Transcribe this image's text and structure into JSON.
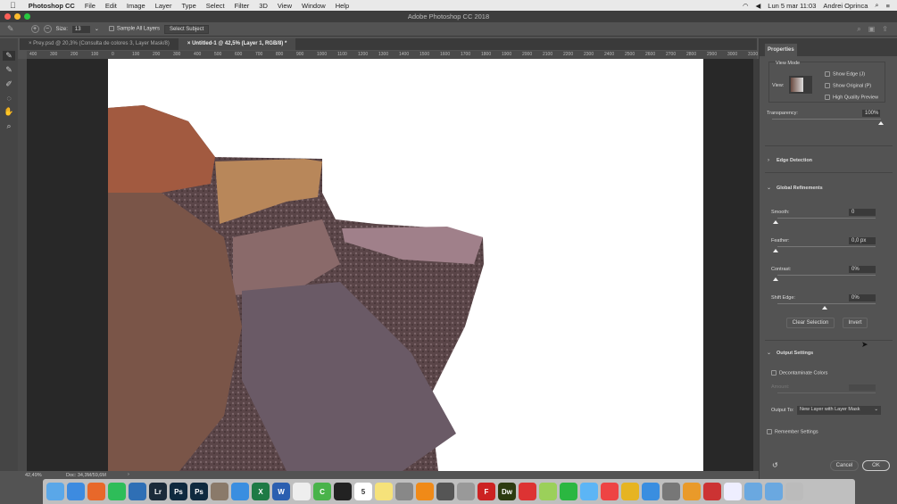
{
  "menubar": {
    "app": "Photoshop CC",
    "items": [
      "File",
      "Edit",
      "Image",
      "Layer",
      "Type",
      "Select",
      "Filter",
      "3D",
      "View",
      "Window",
      "Help"
    ],
    "datetime": "Lun 5 mar  11:03",
    "user": "Andrei Oprinca"
  },
  "window": {
    "title": "Adobe Photoshop CC 2018"
  },
  "options": {
    "size_label": "Size:",
    "size_value": "13",
    "sample_all_layers": "Sample All Layers",
    "select_subject": "Select Subject"
  },
  "tabs": [
    {
      "label": "Prey.psd @ 20,3% (Consulta de colores 3, Layer Mask/8)"
    },
    {
      "label": "Untitled-1 @ 42,5% (Layer 1, RGB/8) *"
    }
  ],
  "ruler": [
    "400",
    "300",
    "200",
    "100",
    "0",
    "100",
    "200",
    "300",
    "400",
    "500",
    "600",
    "700",
    "800",
    "900",
    "1000",
    "1100",
    "1200",
    "1300",
    "1400",
    "1500",
    "1600",
    "1700",
    "1800",
    "1900",
    "2000",
    "2100",
    "2200",
    "2300",
    "2400",
    "2500",
    "2600",
    "2700",
    "2800",
    "2900",
    "3000",
    "3100",
    "3200"
  ],
  "statusbar": {
    "zoom": "42,49%",
    "doc": "Doc: 34,3M/59,6M"
  },
  "panel": {
    "tab": "Properties",
    "view_mode": "View Mode",
    "view_label": "View:",
    "show_edge": "Show Edge (J)",
    "show_original": "Show Original (P)",
    "hq_preview": "High Quality Preview",
    "transparency_label": "Transparency:",
    "transparency_value": "100%",
    "transparency": 100,
    "edge_detection": "Edge Detection",
    "global_refinements": "Global Refinements",
    "smooth_label": "Smooth:",
    "smooth_value": "0",
    "feather_label": "Feather:",
    "feather_value": "0,0 px",
    "contrast_label": "Contrast:",
    "contrast_value": "0%",
    "shift_edge_label": "Shift Edge:",
    "shift_edge_value": "0%",
    "clear_selection": "Clear Selection",
    "invert": "Invert",
    "output_settings": "Output Settings",
    "decontaminate": "Decontaminate Colors",
    "amount_label": "Amount:",
    "output_to_label": "Output To:",
    "output_to_value": "New Layer with Layer Mask",
    "remember": "Remember Settings",
    "cancel": "Cancel",
    "ok": "OK"
  },
  "dock": [
    {
      "name": "Finder",
      "c": "#5aa7e8",
      "t": ""
    },
    {
      "name": "Chrome",
      "c": "#3d8be0",
      "t": ""
    },
    {
      "name": "Firefox",
      "c": "#e8682a",
      "t": ""
    },
    {
      "name": "Spotify",
      "c": "#2ebd59",
      "t": ""
    },
    {
      "name": "Thunderbird",
      "c": "#2f6fb5",
      "t": ""
    },
    {
      "name": "Lightroom",
      "c": "#1b2b3a",
      "t": "Lr"
    },
    {
      "name": "Photoshop",
      "c": "#0f2a3f",
      "t": "Ps"
    },
    {
      "name": "Photoshop 2",
      "c": "#0f2a3f",
      "t": "Ps"
    },
    {
      "name": "Preview",
      "c": "#8a7a6a",
      "t": ""
    },
    {
      "name": "Safari",
      "c": "#3a8ee0",
      "t": ""
    },
    {
      "name": "Excel",
      "c": "#1e7a45",
      "t": "X"
    },
    {
      "name": "Word",
      "c": "#2b5fb0",
      "t": "W"
    },
    {
      "name": "Pages",
      "c": "#eee",
      "t": ""
    },
    {
      "name": "Camtasia",
      "c": "#49b34a",
      "t": "C"
    },
    {
      "name": "Activity",
      "c": "#222",
      "t": ""
    },
    {
      "name": "Calendar",
      "c": "#fff",
      "t": "5"
    },
    {
      "name": "Notes",
      "c": "#f6e27a",
      "t": ""
    },
    {
      "name": "Preferences",
      "c": "#888",
      "t": ""
    },
    {
      "name": "VLC",
      "c": "#f08a18",
      "t": ""
    },
    {
      "name": "Clapper",
      "c": "#555",
      "t": ""
    },
    {
      "name": "Books",
      "c": "#999",
      "t": ""
    },
    {
      "name": "FileZilla",
      "c": "#c22",
      "t": "F"
    },
    {
      "name": "Dreamweaver",
      "c": "#2d3b10",
      "t": "Dw"
    },
    {
      "name": "Mail",
      "c": "#d33",
      "t": ""
    },
    {
      "name": "Maps",
      "c": "#9bd05a",
      "t": ""
    },
    {
      "name": "WhatsApp",
      "c": "#2bb741",
      "t": ""
    },
    {
      "name": "Messages",
      "c": "#5cb5f5",
      "t": ""
    },
    {
      "name": "Recorder",
      "c": "#e44",
      "t": ""
    },
    {
      "name": "Sound",
      "c": "#e6b422",
      "t": ""
    },
    {
      "name": "App Store",
      "c": "#3a8ee0",
      "t": ""
    },
    {
      "name": "Tools",
      "c": "#777",
      "t": ""
    },
    {
      "name": "Cog",
      "c": "#e99a2a",
      "t": ""
    },
    {
      "name": "Photo",
      "c": "#c33",
      "t": ""
    },
    {
      "name": "Doc",
      "c": "#eef",
      "t": ""
    },
    {
      "name": "Folder1",
      "c": "#6aa8e0",
      "t": ""
    },
    {
      "name": "Folder2",
      "c": "#6aa8e0",
      "t": ""
    },
    {
      "name": "Trash",
      "c": "#bbb",
      "t": ""
    }
  ]
}
